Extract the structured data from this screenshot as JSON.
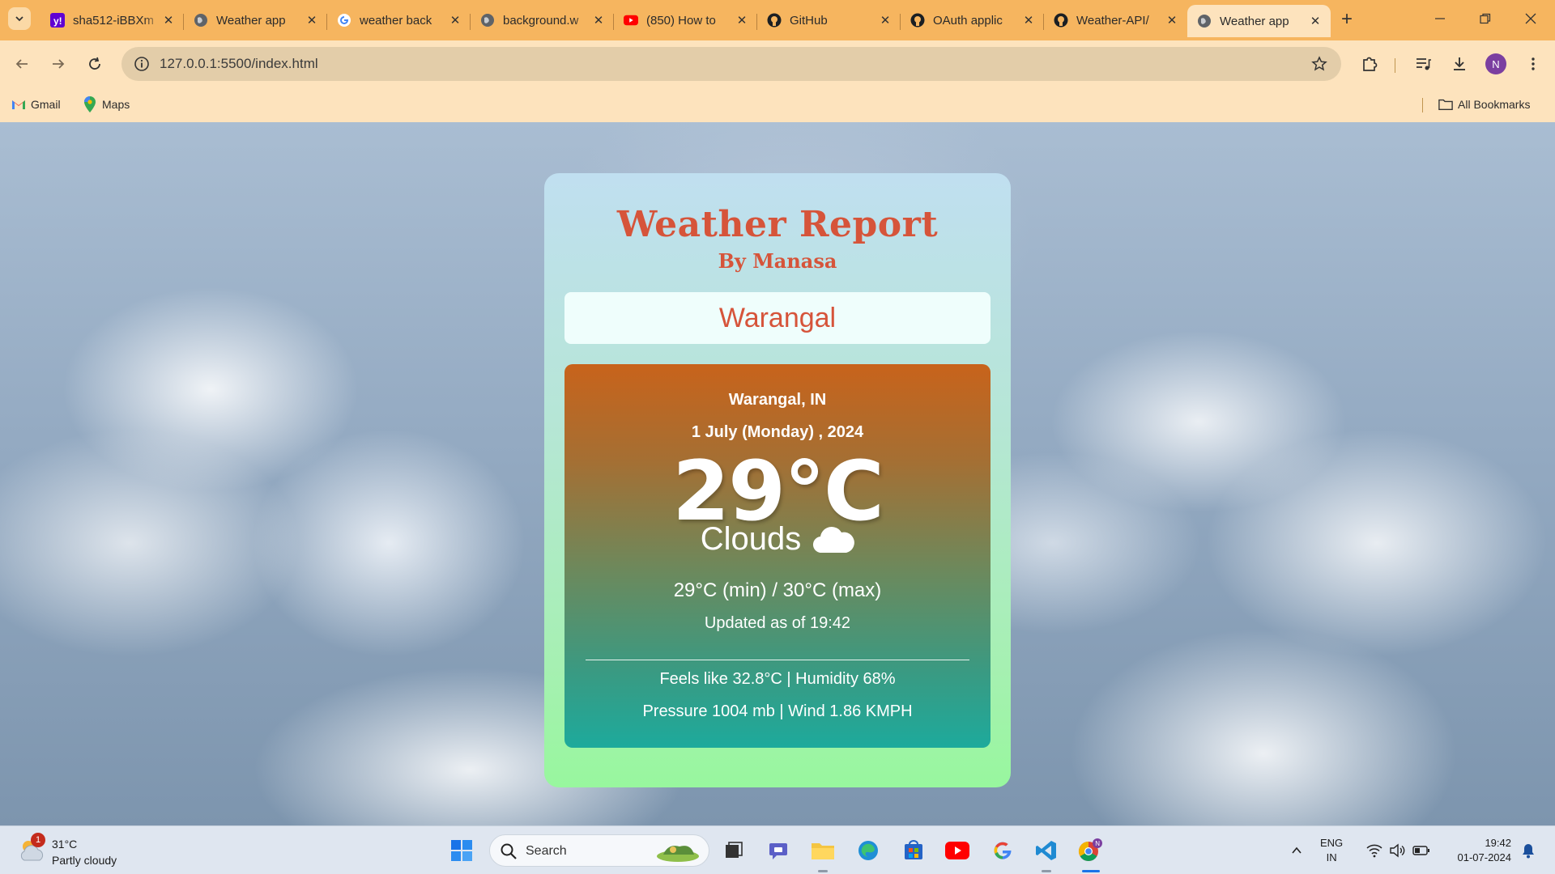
{
  "browser": {
    "tabs": [
      {
        "title": "sha512-iBBXm",
        "icon": "yahoo-icon"
      },
      {
        "title": "Weather app",
        "icon": "globe-icon"
      },
      {
        "title": "weather back",
        "icon": "google-icon"
      },
      {
        "title": "background.w",
        "icon": "globe-icon"
      },
      {
        "title": "(850) How to",
        "icon": "youtube-icon"
      },
      {
        "title": "GitHub",
        "icon": "github-icon"
      },
      {
        "title": "OAuth applic",
        "icon": "github-icon"
      },
      {
        "title": "Weather-API/",
        "icon": "github-icon"
      },
      {
        "title": "Weather app",
        "icon": "globe-icon",
        "active": true
      }
    ],
    "url": "127.0.0.1:5500/index.html",
    "profile_initial": "N",
    "bookmarks": [
      {
        "label": "Gmail",
        "icon": "gmail-icon"
      },
      {
        "label": "Maps",
        "icon": "maps-icon"
      }
    ],
    "all_bookmarks_label": "All Bookmarks",
    "colors": {
      "tab_strip": "#f6b55f",
      "toolbar": "#fde3bd"
    }
  },
  "page": {
    "title": "Weather Report",
    "subtitle": "By Manasa",
    "city_input_value": "Warangal",
    "report": {
      "location": "Warangal, IN",
      "date": "1 July (Monday) , 2024",
      "temperature": "29°C",
      "condition": "Clouds",
      "condition_icon": "cloud-icon",
      "min_max": "29°C (min) / 30°C (max)",
      "updated": "Updated as of 19:42",
      "feels_humidity": "Feels like 32.8°C | Humidity 68%",
      "pressure_wind": "Pressure 1004 mb | Wind 1.86 KMPH"
    },
    "colors": {
      "accent": "#d6543a",
      "card_top": "#c0dff0",
      "card_bottom": "#98f79e",
      "report_top": "#c8631b",
      "report_bottom": "#1daa9c"
    }
  },
  "taskbar": {
    "weather_temp": "31°C",
    "weather_desc": "Partly cloudy",
    "weather_badge": "1",
    "search_label": "Search",
    "language_line1": "ENG",
    "language_line2": "IN",
    "time": "19:42",
    "date": "01-07-2024"
  }
}
